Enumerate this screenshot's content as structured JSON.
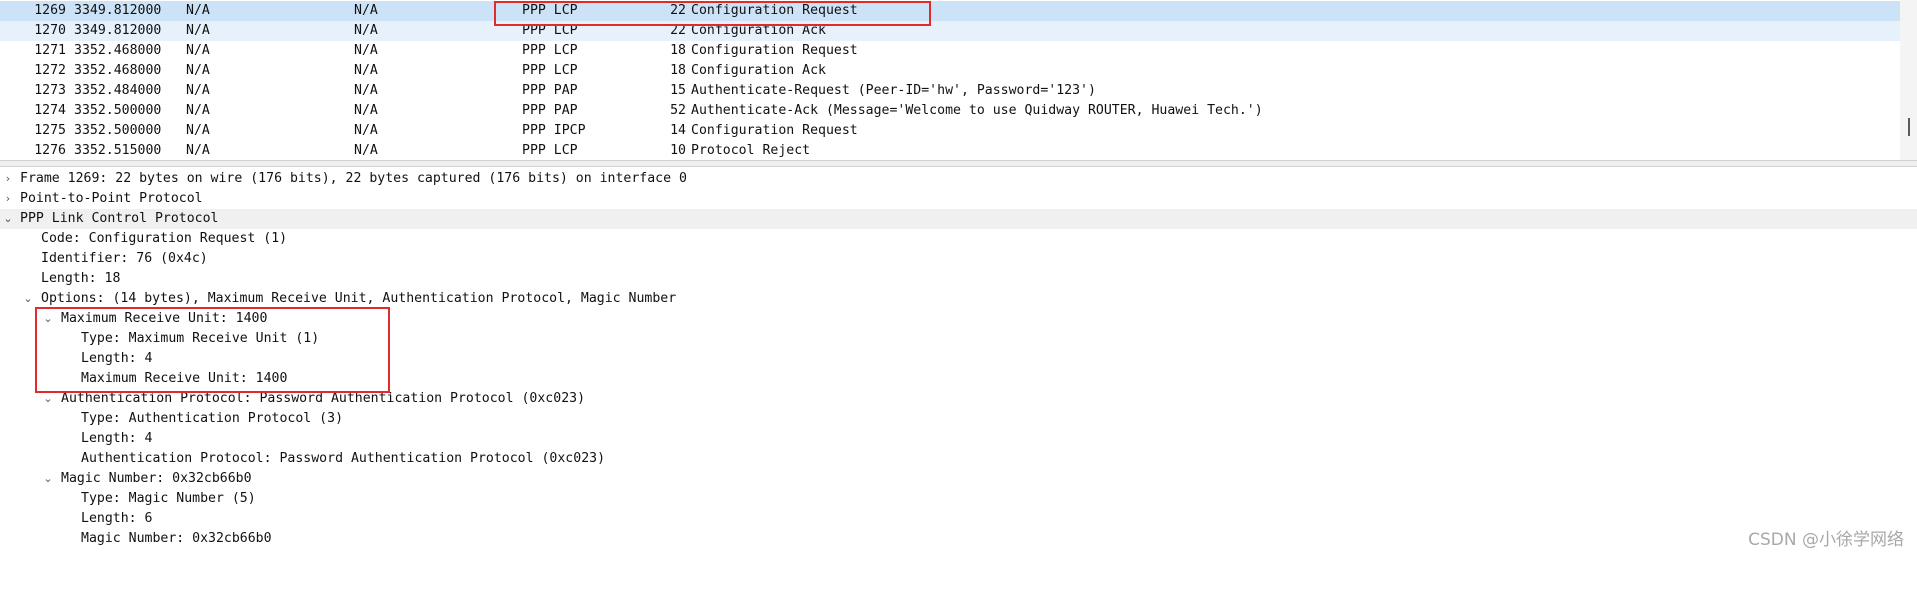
{
  "packet_list": {
    "rows": [
      {
        "no": "1269",
        "time": "3349.812000",
        "source": "N/A",
        "destination": "N/A",
        "protocol": "PPP LCP",
        "length": "22",
        "info": "Configuration Request"
      },
      {
        "no": "1270",
        "time": "3349.812000",
        "source": "N/A",
        "destination": "N/A",
        "protocol": "PPP LCP",
        "length": "22",
        "info": "Configuration Ack"
      },
      {
        "no": "1271",
        "time": "3352.468000",
        "source": "N/A",
        "destination": "N/A",
        "protocol": "PPP LCP",
        "length": "18",
        "info": "Configuration Request"
      },
      {
        "no": "1272",
        "time": "3352.468000",
        "source": "N/A",
        "destination": "N/A",
        "protocol": "PPP LCP",
        "length": "18",
        "info": "Configuration Ack"
      },
      {
        "no": "1273",
        "time": "3352.484000",
        "source": "N/A",
        "destination": "N/A",
        "protocol": "PPP PAP",
        "length": "15",
        "info": "Authenticate-Request (Peer-ID='hw', Password='123')"
      },
      {
        "no": "1274",
        "time": "3352.500000",
        "source": "N/A",
        "destination": "N/A",
        "protocol": "PPP PAP",
        "length": "52",
        "info": "Authenticate-Ack (Message='Welcome to use Quidway ROUTER, Huawei Tech.')"
      },
      {
        "no": "1275",
        "time": "3352.500000",
        "source": "N/A",
        "destination": "N/A",
        "protocol": "PPP IPCP",
        "length": "14",
        "info": "Configuration Request"
      },
      {
        "no": "1276",
        "time": "3352.515000",
        "source": "N/A",
        "destination": "N/A",
        "protocol": "PPP LCP",
        "length": "10",
        "info": "Protocol Reject"
      }
    ]
  },
  "details": {
    "frame": "Frame 1269: 22 bytes on wire (176 bits), 22 bytes captured (176 bits) on interface 0",
    "ppp": "Point-to-Point Protocol",
    "lcp": "PPP Link Control Protocol",
    "code": "Code: Configuration Request (1)",
    "identifier": "Identifier: 76 (0x4c)",
    "length": "Length: 18",
    "options": "Options: (14 bytes), Maximum Receive Unit, Authentication Protocol, Magic Number",
    "mru": {
      "header": "Maximum Receive Unit: 1400",
      "type": "Type: Maximum Receive Unit (1)",
      "length": "Length: 4",
      "value": "Maximum Receive Unit: 1400"
    },
    "auth": {
      "header": "Authentication Protocol: Password Authentication Protocol (0xc023)",
      "type": "Type: Authentication Protocol (3)",
      "length": "Length: 4",
      "value": "Authentication Protocol: Password Authentication Protocol (0xc023)"
    },
    "magic": {
      "header": "Magic Number: 0x32cb66b0",
      "type": "Type: Magic Number (5)",
      "length": "Length: 6",
      "value": "Magic Number: 0x32cb66b0"
    }
  },
  "icons": {
    "collapsed": "›",
    "expanded": "⌄"
  },
  "colors": {
    "selected_row": "#cce3f7",
    "highlight": "#e02b2b"
  },
  "watermark": "CSDN @小徐学网络"
}
